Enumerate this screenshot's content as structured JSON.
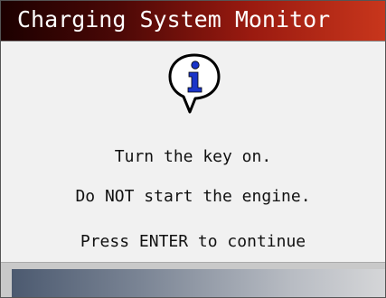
{
  "window": {
    "title": "Charging System Monitor"
  },
  "dialog": {
    "icon": "info-speech-bubble-icon",
    "line1": "Turn the key on.",
    "line2": "Do NOT start the engine.",
    "line3": "Press ENTER to continue"
  },
  "colors": {
    "title_bar_dark": "#1c0000",
    "title_bar_light": "#c8361c",
    "info_icon_fill": "#1a35c8",
    "content_background": "#f1f1f1",
    "bottom_bar_dark": "#4c5a70",
    "bottom_bar_light": "#d5d6d8"
  }
}
